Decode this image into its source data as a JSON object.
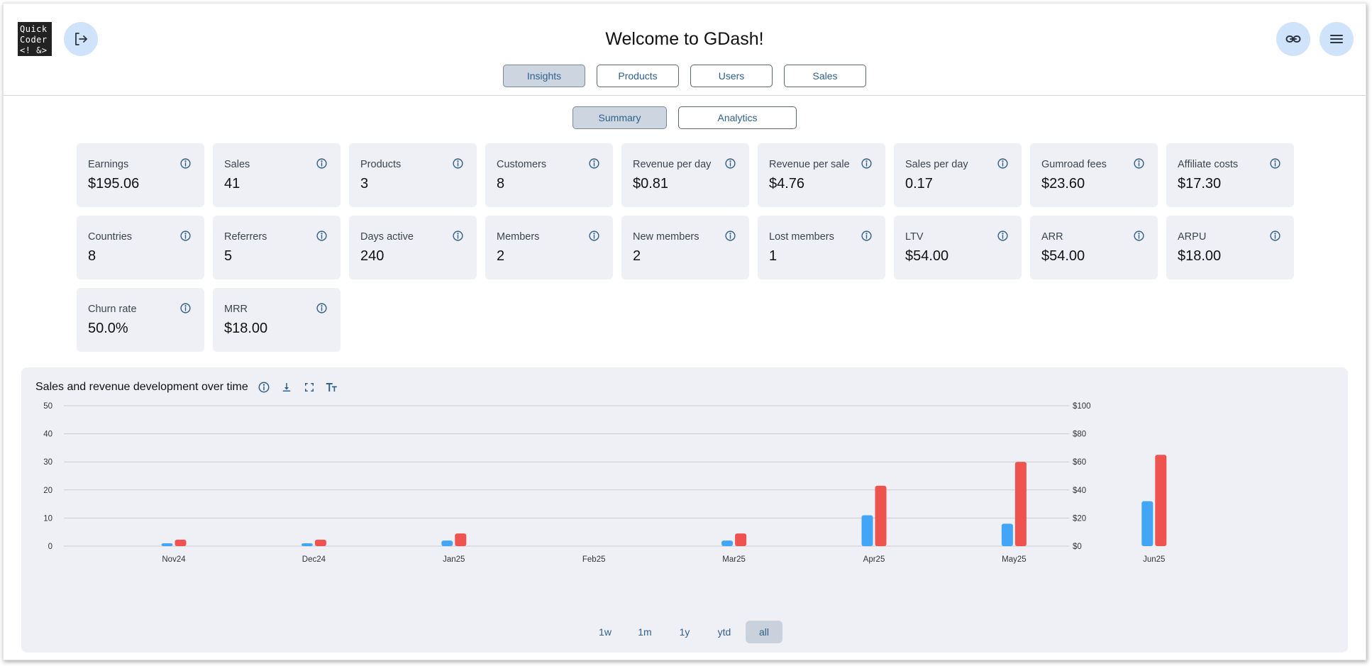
{
  "logo": {
    "text": "Quick\nCoder\n<! &>"
  },
  "header": {
    "title": "Welcome to GDash!"
  },
  "main_tabs": [
    {
      "label": "Insights",
      "active": true
    },
    {
      "label": "Products",
      "active": false
    },
    {
      "label": "Users",
      "active": false
    },
    {
      "label": "Sales",
      "active": false
    }
  ],
  "sub_tabs": [
    {
      "label": "Summary",
      "active": true
    },
    {
      "label": "Analytics",
      "active": false
    }
  ],
  "icons": {
    "logout": "logout-icon",
    "link": "link-icon",
    "menu": "menu-icon",
    "info": "info-icon",
    "download": "download-icon",
    "fullscreen": "fullscreen-icon",
    "text_size": "text-size-icon"
  },
  "metrics": [
    {
      "label": "Earnings",
      "value": "$195.06"
    },
    {
      "label": "Sales",
      "value": "41"
    },
    {
      "label": "Products",
      "value": "3"
    },
    {
      "label": "Customers",
      "value": "8"
    },
    {
      "label": "Revenue per day",
      "value": "$0.81"
    },
    {
      "label": "Revenue per sale",
      "value": "$4.76"
    },
    {
      "label": "Sales per day",
      "value": "0.17"
    },
    {
      "label": "Gumroad fees",
      "value": "$23.60"
    },
    {
      "label": "Affiliate costs",
      "value": "$17.30"
    },
    {
      "label": "Countries",
      "value": "8"
    },
    {
      "label": "Referrers",
      "value": "5"
    },
    {
      "label": "Days active",
      "value": "240"
    },
    {
      "label": "Members",
      "value": "2"
    },
    {
      "label": "New members",
      "value": "2"
    },
    {
      "label": "Lost members",
      "value": "1"
    },
    {
      "label": "LTV",
      "value": "$54.00"
    },
    {
      "label": "ARR",
      "value": "$54.00"
    },
    {
      "label": "ARPU",
      "value": "$18.00"
    },
    {
      "label": "Churn rate",
      "value": "50.0%"
    },
    {
      "label": "MRR",
      "value": "$18.00"
    }
  ],
  "chart": {
    "title": "Sales and revenue development over time",
    "range_buttons": [
      {
        "label": "1w",
        "active": false
      },
      {
        "label": "1m",
        "active": false
      },
      {
        "label": "1y",
        "active": false
      },
      {
        "label": "ytd",
        "active": false
      },
      {
        "label": "all",
        "active": true
      }
    ]
  },
  "colors": {
    "sales": "#42a5f5",
    "revenue": "#ef5350",
    "accent": "#2f5f8a",
    "grid": "#c9ccd2"
  },
  "chart_data": {
    "type": "bar",
    "categories": [
      "Nov24",
      "Dec24",
      "Jan25",
      "Feb25",
      "Mar25",
      "Apr25",
      "May25",
      "Jun25"
    ],
    "series": [
      {
        "axis": "left",
        "values": [
          1,
          1,
          2,
          0,
          2,
          11,
          8,
          16
        ]
      },
      {
        "axis": "right",
        "values": [
          4.6,
          4.6,
          9,
          0,
          9,
          43,
          60,
          65
        ]
      }
    ],
    "y_left": {
      "ticks": [
        "0",
        "10",
        "20",
        "30",
        "40",
        "50"
      ],
      "ylim": [
        0,
        50
      ]
    },
    "y_right": {
      "ticks": [
        "$0",
        "$20",
        "$40",
        "$60",
        "$80",
        "$100"
      ],
      "ylim": [
        0,
        100
      ]
    },
    "grid": true,
    "legend": "none"
  }
}
